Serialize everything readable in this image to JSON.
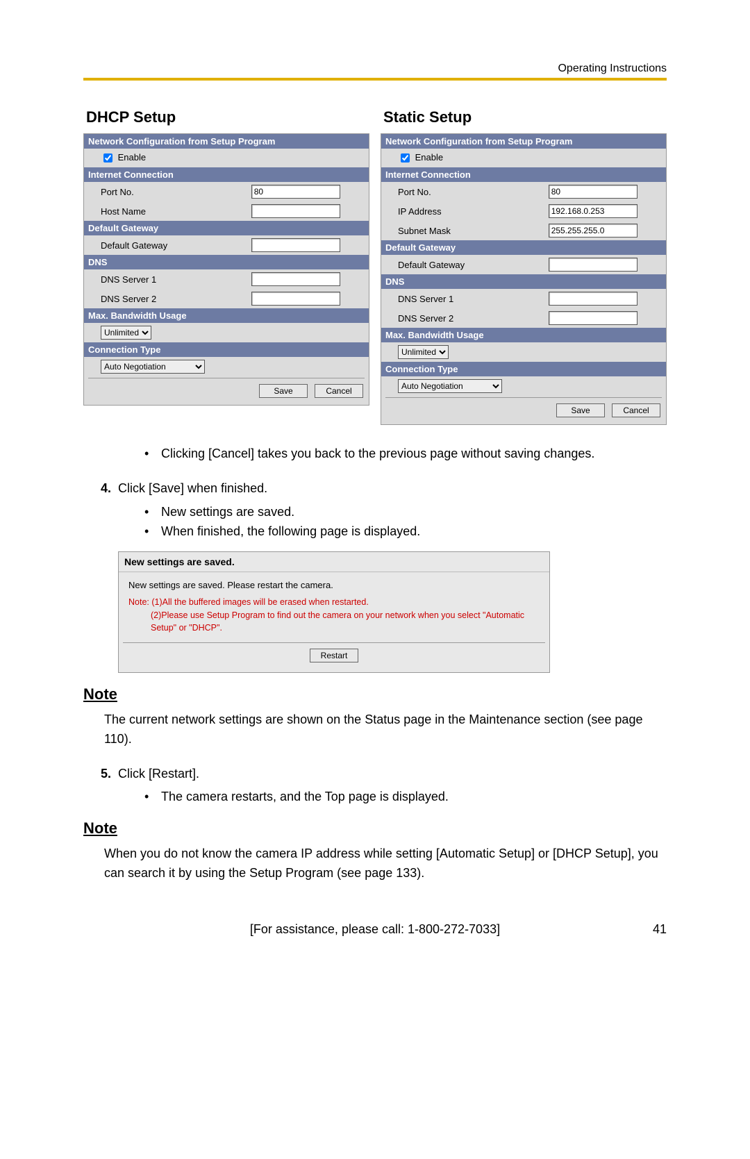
{
  "header": {
    "doc_section": "Operating Instructions"
  },
  "dhcp": {
    "title": "DHCP Setup",
    "sections": {
      "netcfg_header": "Network Configuration from Setup Program",
      "enable_label": "Enable",
      "inet_header": "Internet Connection",
      "port_label": "Port No.",
      "port_value": "80",
      "host_label": "Host Name",
      "host_value": "",
      "gw_header": "Default Gateway",
      "gw_label": "Default Gateway",
      "gw_value": "",
      "dns_header": "DNS",
      "dns1_label": "DNS Server 1",
      "dns1_value": "",
      "dns2_label": "DNS Server 2",
      "dns2_value": "",
      "bw_header": "Max. Bandwidth Usage",
      "bw_value": "Unlimited",
      "ct_header": "Connection Type",
      "ct_value": "Auto Negotiation"
    },
    "buttons": {
      "save": "Save",
      "cancel": "Cancel"
    }
  },
  "static": {
    "title": "Static Setup",
    "sections": {
      "netcfg_header": "Network Configuration from Setup Program",
      "enable_label": "Enable",
      "inet_header": "Internet Connection",
      "port_label": "Port No.",
      "port_value": "80",
      "ip_label": "IP Address",
      "ip_value": "192.168.0.253",
      "mask_label": "Subnet Mask",
      "mask_value": "255.255.255.0",
      "gw_header": "Default Gateway",
      "gw_label": "Default Gateway",
      "gw_value": "",
      "dns_header": "DNS",
      "dns1_label": "DNS Server 1",
      "dns1_value": "",
      "dns2_label": "DNS Server 2",
      "dns2_value": "",
      "bw_header": "Max. Bandwidth Usage",
      "bw_value": "Unlimited",
      "ct_header": "Connection Type",
      "ct_value": "Auto Negotiation"
    },
    "buttons": {
      "save": "Save",
      "cancel": "Cancel"
    }
  },
  "text": {
    "cancel_bullet": "Clicking [Cancel] takes you back to the previous page without saving changes.",
    "step4": "Click [Save] when finished.",
    "step4_b1": "New settings are saved.",
    "step4_b2": "When finished, the following page is displayed.",
    "note_label": "Note",
    "note1_body": "The current network settings are shown on the Status page in the Maintenance section (see page 110).",
    "step5": "Click [Restart].",
    "step5_b1": "The camera restarts, and the Top page is displayed.",
    "note2_body": "When you do not know the camera IP address while setting [Automatic Setup] or [DHCP Setup], you can search it by using the Setup Program (see page 133)."
  },
  "saved": {
    "title": "New settings are saved.",
    "line1": "New settings are saved. Please restart the camera.",
    "note_prefix": "Note:",
    "note_l1": "(1)All the buffered images will be erased when restarted.",
    "note_l2": "(2)Please use Setup Program to find out the camera on your network when you select \"Automatic Setup\" or \"DHCP\".",
    "restart": "Restart"
  },
  "footer": {
    "assist": "[For assistance, please call: 1-800-272-7033]",
    "page": "41"
  },
  "nums": {
    "four": "4.",
    "five": "5."
  }
}
